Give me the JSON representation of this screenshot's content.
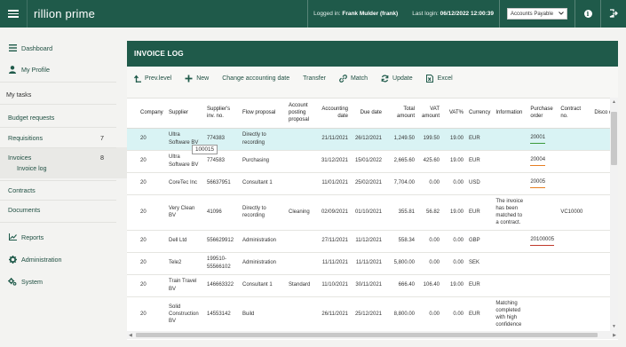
{
  "app": {
    "logo": "rillion prime"
  },
  "topbar": {
    "logged_in_label": "Logged in:",
    "logged_in_user": "Frank Mulder (frank)",
    "last_login_label": "Last login:",
    "last_login_value": "06/12/2022 12:00:39",
    "role_select_value": "Accounts Payable"
  },
  "sidebar": {
    "dashboard": "Dashboard",
    "my_profile": "My Profile",
    "my_tasks": "My tasks",
    "budget_requests": "Budget requests",
    "requisitions": "Requisitions",
    "requisitions_count": "7",
    "invoices": "Invoices",
    "invoices_count": "8",
    "invoice_log": "Invoice log",
    "contracts": "Contracts",
    "documents": "Documents",
    "reports": "Reports",
    "administration": "Administration",
    "system": "System"
  },
  "panel": {
    "title": "INVOICE LOG"
  },
  "toolbar": {
    "prev_level": "Prev.level",
    "new": "New",
    "change_accounting_date": "Change accounting date",
    "transfer": "Transfer",
    "match": "Match",
    "update": "Update",
    "excel": "Excel"
  },
  "table": {
    "headers": {
      "company": "Company",
      "supplier": "Supplier",
      "supplier_inv_no": "Supplier's inv. no.",
      "flow_proposal": "Flow proposal",
      "account_posting_proposal": "Account posting proposal",
      "accounting_date": "Accounting date",
      "due_date": "Due date",
      "total_amount": "Total amount",
      "vat_amount": "VAT amount",
      "vat_pct": "VAT%",
      "currency": "Currency",
      "information": "Information",
      "purchase_order": "Purchase order",
      "contract_no": "Contract no.",
      "discount": "Disco d"
    },
    "rows": [
      {
        "company": "20",
        "supplier": "Ultra Software BV",
        "inv_no": "774383",
        "flow": "Directly to recording",
        "account": "",
        "acc_date": "21/11/2021",
        "due_date": "26/12/2021",
        "total": "1,249.50",
        "vat_amount": "199.50",
        "vat_pct": "19.00",
        "currency": "EUR",
        "info": "",
        "po": "20001",
        "po_color": "#3a9a3a",
        "contract": ""
      },
      {
        "company": "20",
        "supplier": "Ultra Software BV",
        "inv_no": "774583",
        "flow": "Purchasing",
        "account": "",
        "acc_date": "31/12/2021",
        "due_date": "15/01/2022",
        "total": "2,665.60",
        "vat_amount": "425.60",
        "vat_pct": "19.00",
        "currency": "EUR",
        "info": "",
        "po": "20004",
        "po_color": "#e67e22",
        "contract": ""
      },
      {
        "company": "20",
        "supplier": "CoreTec Inc",
        "inv_no": "56637951",
        "flow": "Consultant 1",
        "account": "",
        "acc_date": "11/01/2021",
        "due_date": "25/02/2021",
        "total": "7,704.00",
        "vat_amount": "0.00",
        "vat_pct": "0.00",
        "currency": "USD",
        "info": "",
        "po": "20005",
        "po_color": "#e67e22",
        "contract": ""
      },
      {
        "company": "20",
        "supplier": "Very Clean BV",
        "inv_no": "41096",
        "flow": "Directly to recording",
        "account": "Cleaning",
        "acc_date": "02/09/2021",
        "due_date": "01/10/2021",
        "total": "355.81",
        "vat_amount": "56.82",
        "vat_pct": "19.00",
        "currency": "EUR",
        "info": "The invoice has been matched to a contract.",
        "po": "",
        "po_color": "",
        "contract": "VC10000"
      },
      {
        "company": "20",
        "supplier": "Dell Ltd",
        "inv_no": "556629912",
        "flow": "Administration",
        "account": "",
        "acc_date": "27/11/2021",
        "due_date": "11/12/2021",
        "total": "558.34",
        "vat_amount": "0.00",
        "vat_pct": "0.00",
        "currency": "GBP",
        "info": "",
        "po": "20100005",
        "po_color": "#c0392b",
        "contract": ""
      },
      {
        "company": "20",
        "supplier": "Tele2",
        "inv_no": "199510-55566102",
        "flow": "Administration",
        "account": "",
        "acc_date": "11/11/2021",
        "due_date": "11/11/2021",
        "total": "5,800.00",
        "vat_amount": "0.00",
        "vat_pct": "0.00",
        "currency": "SEK",
        "info": "",
        "po": "",
        "po_color": "",
        "contract": ""
      },
      {
        "company": "20",
        "supplier": "Train Travel BV",
        "inv_no": "146663322",
        "flow": "Consultant 1",
        "account": "Standard",
        "acc_date": "11/10/2021",
        "due_date": "30/11/2021",
        "total": "666.40",
        "vat_amount": "106.40",
        "vat_pct": "19.00",
        "currency": "EUR",
        "info": "",
        "po": "",
        "po_color": "",
        "contract": ""
      },
      {
        "company": "20",
        "supplier": "Solid Construction BV",
        "inv_no": "14553142",
        "flow": "Build",
        "account": "",
        "acc_date": "26/11/2021",
        "due_date": "25/12/2021",
        "total": "8,800.00",
        "vat_amount": "0.00",
        "vat_pct": "0.00",
        "currency": "EUR",
        "info": "Matching completed with high confidence",
        "po": "",
        "po_color": "",
        "contract": ""
      }
    ]
  },
  "tooltip": {
    "text": "100015"
  }
}
